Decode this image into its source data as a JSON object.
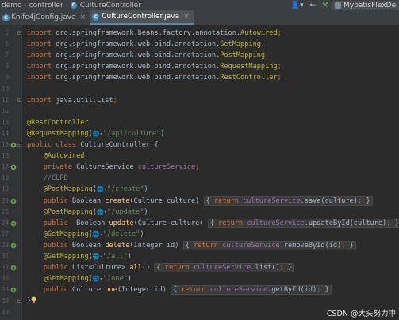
{
  "navbar": {
    "crumbs": [
      "demo",
      "controller",
      "CultureController"
    ],
    "run_config": "MybatisFlexDe"
  },
  "tabs": [
    {
      "label": "Knife4jConfig.java",
      "active": false
    },
    {
      "label": "CultureController.java",
      "active": true
    }
  ],
  "editor": {
    "lines": [
      {
        "n": "5",
        "html": "<span class='kw'>import</span> org.springframework.beans.factory.annotation.<span class='ann'>Autowired</span><span class='kw'>;</span>"
      },
      {
        "n": "6",
        "html": "<span class='kw'>import</span> org.springframework.web.bind.annotation.<span class='ann'>GetMapping</span><span class='kw'>;</span>"
      },
      {
        "n": "7",
        "html": "<span class='kw'>import</span> org.springframework.web.bind.annotation.<span class='ann'>PostMapping</span><span class='kw'>;</span>"
      },
      {
        "n": "8",
        "html": "<span class='kw'>import</span> org.springframework.web.bind.annotation.<span class='ann'>RequestMapping</span><span class='kw'>;</span>"
      },
      {
        "n": "9",
        "html": "<span class='kw'>import</span> org.springframework.web.bind.annotation.<span class='ann'>RestController</span><span class='kw'>;</span>"
      },
      {
        "n": "10",
        "html": ""
      },
      {
        "n": "11",
        "html": "<span class='kw'>import</span> java.util.List<span class='kw'>;</span>"
      },
      {
        "n": "12",
        "html": ""
      },
      {
        "n": "13",
        "html": "<span class='ann'>@RestController</span>"
      },
      {
        "n": "14",
        "html": "<span class='ann'>@RequestMapping</span>(<span class='globe'>🌐▾</span><span class='str'>\"/api/culture\"</span>)"
      },
      {
        "n": "15",
        "html": "<span class='kw'>public class</span> CultureController {"
      },
      {
        "n": "16",
        "html": "    <span class='ann'>@Autowired</span>"
      },
      {
        "n": "17",
        "html": "    <span class='kw'>private</span> CultureService <span class='fld'>cultureService</span><span class='kw'>;</span>"
      },
      {
        "n": "18",
        "html": "    <span class='cmt'>//CURD</span>"
      },
      {
        "n": "19",
        "html": "    <span class='ann'>@PostMapping</span>(<span class='globe'>🌐▾</span><span class='str'>\"/create\"</span>)"
      },
      {
        "n": "20",
        "html": "    <span class='kw'>public</span> Boolean <span class='fn'>create</span>(Culture culture) <span class='fold'>{ <span class='kw'>return</span> <span class='fld'>cultureService</span>.save(culture)<span class='kw'>;</span> }</span>"
      },
      {
        "n": "23",
        "html": "    <span class='ann'>@PostMapping</span>(<span class='globe'>🌐▾</span><span class='str'>\"/update\"</span>)"
      },
      {
        "n": "24",
        "html": "    <span class='kw'>public</span>  Boolean <span class='fn'>update</span>(Culture culture) <span class='fold'>{ <span class='kw'>return</span> <span class='fld'>cultureService</span>.updateById(culture)<span class='kw'>;</span> }</span>"
      },
      {
        "n": "27",
        "html": "    <span class='ann'>@GetMapping</span>(<span class='globe'>🌐▾</span><span class='str'>\"/delete\"</span>)"
      },
      {
        "n": "28",
        "html": "    <span class='kw'>public</span> Boolean <span class='fn'>delete</span>(Integer id) <span class='fold'>{ <span class='kw'>return</span> <span class='fld'>cultureService</span>.removeById(id)<span class='kw'>;</span> }</span>"
      },
      {
        "n": "31",
        "html": "    <span class='ann'>@GetMapping</span>(<span class='globe'>🌐▾</span><span class='str'>\"/all\"</span>)"
      },
      {
        "n": "32",
        "html": "    <span class='kw'>public</span> List&lt;Culture&gt; <span class='fn'>all</span>() <span class='fold'>{ <span class='kw'>return</span> <span class='fld'>cultureService</span>.list()<span class='kw'>;</span> }</span>"
      },
      {
        "n": "35",
        "html": "    <span class='ann'>@GetMapping</span>(<span class='globe'>🌐▾</span><span class='str'>\"/one\"</span>)"
      },
      {
        "n": "36",
        "html": "    <span class='kw'>public</span> Culture <span class='fn'>one</span>(Integer id) <span class='fold'>{ <span class='kw'>return</span> <span class='fld'>cultureService</span>.getById(id)<span class='kw'>;</span> }</span>"
      },
      {
        "n": "39",
        "html": "}"
      },
      {
        "n": "40",
        "html": ""
      }
    ]
  },
  "watermark": "CSDN @大头努力中"
}
